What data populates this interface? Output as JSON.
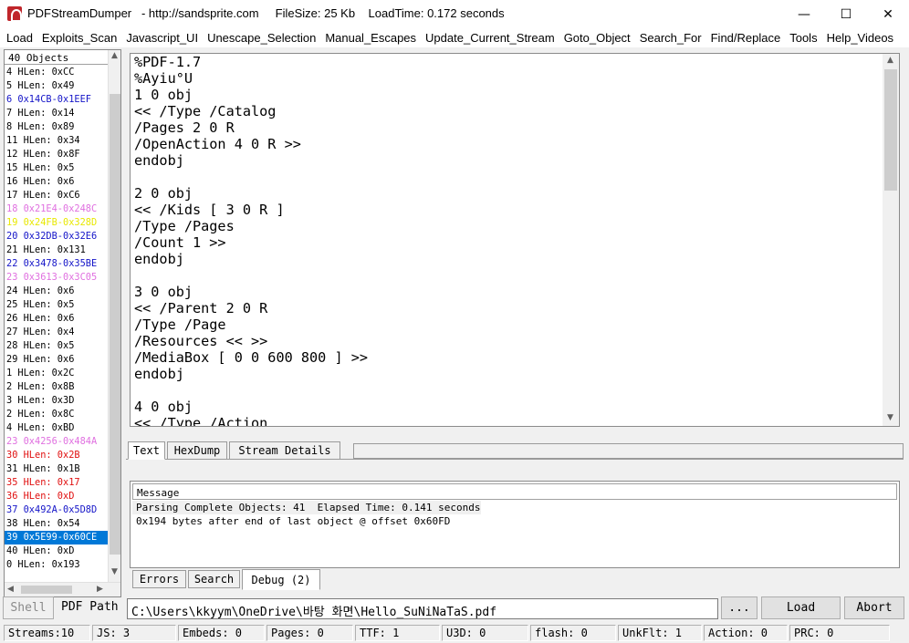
{
  "window": {
    "title": "PDFStreamDumper   - http://sandsprite.com     FileSize: 25 Kb    LoadTime: 0.172 seconds",
    "minimize": "—",
    "maximize": "☐",
    "close": "✕"
  },
  "menu": [
    "Load",
    "Exploits_Scan",
    "Javascript_UI",
    "Unescape_Selection",
    "Manual_Escapes",
    "Update_Current_Stream",
    "Goto_Object",
    "Search_For",
    "Find/Replace",
    "Tools",
    "Help_Videos"
  ],
  "objects_list": {
    "header": "40 Objects",
    "items": [
      {
        "text": "4 HLen: 0xCC",
        "color": "#000000"
      },
      {
        "text": "5 HLen: 0x49",
        "color": "#000000"
      },
      {
        "text": "6 0x14CB-0x1EEF",
        "color": "#1414c8"
      },
      {
        "text": "7 HLen: 0x14",
        "color": "#000000"
      },
      {
        "text": "8 HLen: 0x89",
        "color": "#000000"
      },
      {
        "text": "11 HLen: 0x34",
        "color": "#000000"
      },
      {
        "text": "12 HLen: 0x8F",
        "color": "#000000"
      },
      {
        "text": "15 HLen: 0x5",
        "color": "#000000"
      },
      {
        "text": "16 HLen: 0x6",
        "color": "#000000"
      },
      {
        "text": "17 HLen: 0xC6",
        "color": "#000000"
      },
      {
        "text": "18 0x21E4-0x248C",
        "color": "#e070e0"
      },
      {
        "text": "19 0x24FB-0x328D",
        "color": "#e8e800"
      },
      {
        "text": "20 0x32DB-0x32E6",
        "color": "#1414c8"
      },
      {
        "text": "21 HLen: 0x131",
        "color": "#000000"
      },
      {
        "text": "22 0x3478-0x35BE",
        "color": "#1414c8"
      },
      {
        "text": "23 0x3613-0x3C05",
        "color": "#e070e0"
      },
      {
        "text": "24 HLen: 0x6",
        "color": "#000000"
      },
      {
        "text": "25 HLen: 0x5",
        "color": "#000000"
      },
      {
        "text": "26 HLen: 0x6",
        "color": "#000000"
      },
      {
        "text": "27 HLen: 0x4",
        "color": "#000000"
      },
      {
        "text": "28 HLen: 0x5",
        "color": "#000000"
      },
      {
        "text": "29 HLen: 0x6",
        "color": "#000000"
      },
      {
        "text": "1 HLen: 0x2C",
        "color": "#000000"
      },
      {
        "text": "2 HLen: 0x8B",
        "color": "#000000"
      },
      {
        "text": "3 HLen: 0x3D",
        "color": "#000000"
      },
      {
        "text": "2 HLen: 0x8C",
        "color": "#000000"
      },
      {
        "text": "4 HLen: 0xBD",
        "color": "#000000"
      },
      {
        "text": "23 0x4256-0x484A",
        "color": "#e070e0"
      },
      {
        "text": "30 HLen: 0x2B",
        "color": "#e01010"
      },
      {
        "text": "31 HLen: 0x1B",
        "color": "#000000"
      },
      {
        "text": "35 HLen: 0x17",
        "color": "#e01010"
      },
      {
        "text": "36 HLen: 0xD",
        "color": "#e01010"
      },
      {
        "text": "37 0x492A-0x5D8D",
        "color": "#1414c8"
      },
      {
        "text": "38 HLen: 0x54",
        "color": "#000000"
      },
      {
        "text": "39 0x5E99-0x60CE",
        "color": "#ffffff",
        "selected": true
      },
      {
        "text": "40 HLen: 0xD",
        "color": "#000000"
      },
      {
        "text": "0 HLen: 0x193",
        "color": "#000000"
      }
    ]
  },
  "editor": {
    "lines": [
      "%PDF-1.7",
      "%Ayiu°U",
      "1 0 obj",
      "<< /Type /Catalog",
      "/Pages 2 0 R",
      "/OpenAction 4 0 R >>",
      "endobj",
      "",
      "2 0 obj",
      "<< /Kids [ 3 0 R ]",
      "/Type /Pages",
      "/Count 1 >>",
      "endobj",
      "",
      "3 0 obj",
      "<< /Parent 2 0 R",
      "/Type /Page",
      "/Resources << >>",
      "/MediaBox [ 0 0 600 800 ] >>",
      "endobj",
      "",
      "4 0 obj",
      "<< /Type /Action"
    ]
  },
  "stream_tabs": [
    "Text",
    "HexDump",
    "Stream Details"
  ],
  "messages": {
    "header": "Message",
    "lines": [
      "Parsing Complete Objects: 41  Elapsed Time: 0.141 seconds",
      "0x194 bytes after end of last object @ offset 0x60FD"
    ]
  },
  "log_tabs": [
    "Errors",
    "Search",
    "Debug (2)"
  ],
  "path_row": {
    "shell_label": "Shell",
    "pdf_path_label": "PDF Path",
    "pdf_path_value": "C:\\Users\\kkyym\\OneDrive\\바탕 화면\\Hello_SuNiNaTaS.pdf",
    "browse_label": "...",
    "load_label": "Load",
    "abort_label": "Abort"
  },
  "status": [
    "Streams:10",
    "JS: 3",
    "Embeds: 0",
    "Pages: 0",
    "TTF: 1",
    "U3D: 0",
    "flash: 0",
    "UnkFlt: 1",
    "Action: 0",
    "PRC: 0"
  ]
}
